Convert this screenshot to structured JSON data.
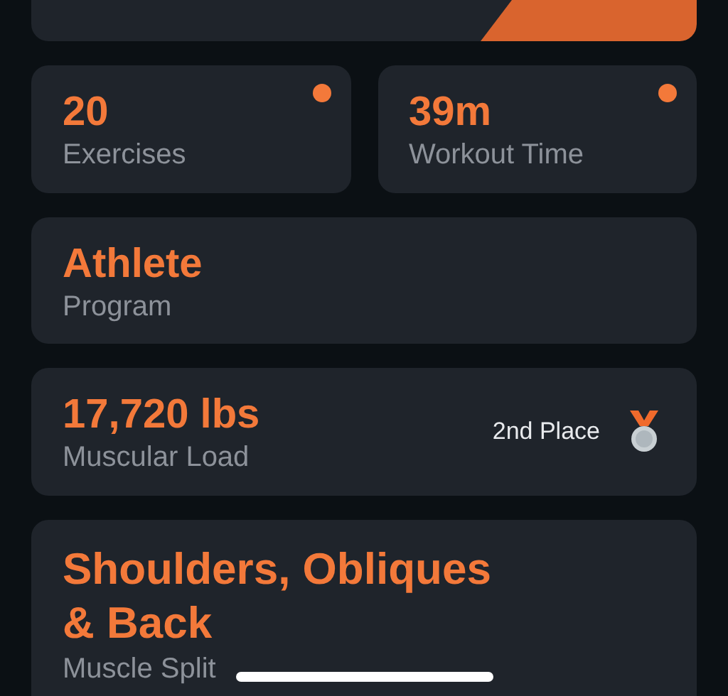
{
  "stats": [
    {
      "value": "20",
      "label": "Exercises",
      "indicator": true
    },
    {
      "value": "39m",
      "label": "Workout Time",
      "indicator": true
    }
  ],
  "program": {
    "value": "Athlete",
    "label": "Program"
  },
  "load": {
    "value": "17,720 lbs",
    "label": "Muscular Load",
    "rank": "2nd Place"
  },
  "split": {
    "value": "Shoulders, Obliques & Back",
    "label": "Muscle Split"
  }
}
